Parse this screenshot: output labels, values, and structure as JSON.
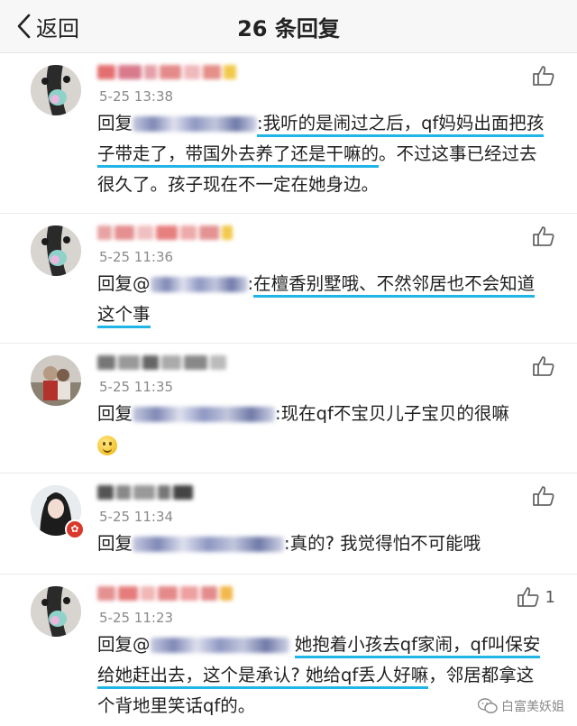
{
  "header": {
    "back_label": "返回",
    "title": "26 条回复"
  },
  "replies": [
    {
      "time": "5-25 13:38",
      "prefix": "回复",
      "segments": [
        {
          "text": ":我听的是闹过之后，qf妈妈出面把孩子带走了，带国外去养了还是干嘛的",
          "highlight": true
        },
        {
          "text": "。不过这事已经过去很久了。孩子现在不一定在她身边。",
          "highlight": false
        }
      ]
    },
    {
      "time": "5-25 11:36",
      "prefix": "回复@",
      "segments": [
        {
          "text": ":",
          "highlight": false
        },
        {
          "text": "在檀香别墅哦、不然邻居也不会知道这个事",
          "highlight": true
        }
      ]
    },
    {
      "time": "5-25 11:35",
      "prefix": "回复",
      "segments": [
        {
          "text": ":现在qf不宝贝儿子宝贝的很嘛",
          "highlight": false
        }
      ],
      "emoji": "smile-emoji"
    },
    {
      "time": "5-25 11:34",
      "prefix": "回复",
      "segments": [
        {
          "text": ":真的? 我觉得怕不可能哦",
          "highlight": false
        }
      ]
    },
    {
      "time": "5-25 11:23",
      "prefix": "回复@",
      "like_count": "1",
      "segments": [
        {
          "text": " ",
          "highlight": false
        },
        {
          "text": "她抱着小孩去qf家闹，qf叫保安给她赶出去，这个是承认? 她给qf丢人好嘛",
          "highlight": true
        },
        {
          "text": "，邻居都拿这个背地里笑话qf的。",
          "highlight": false
        }
      ]
    }
  ],
  "watermark": {
    "text": "白富美妖姐",
    "icon": "wechat-icon"
  },
  "colors": {
    "highlight": "#1fb5e6",
    "time": "#8a8a8a",
    "header_bg": "#f7f7f7"
  }
}
